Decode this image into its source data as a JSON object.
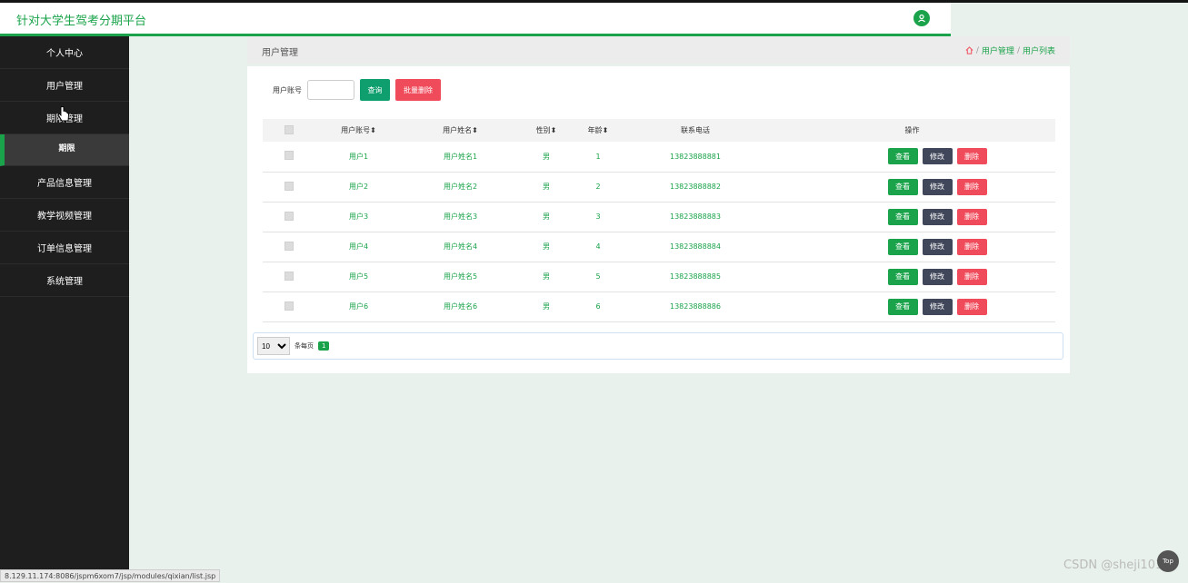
{
  "header": {
    "brand": "针对大学生驾考分期平台",
    "user_icon": "user-icon"
  },
  "sidebar": {
    "items": [
      {
        "label": "个人中心"
      },
      {
        "label": "用户管理"
      },
      {
        "label": "期限管理"
      },
      {
        "label": "期限"
      },
      {
        "label": "产品信息管理"
      },
      {
        "label": "教学视频管理"
      },
      {
        "label": "订单信息管理"
      },
      {
        "label": "系统管理"
      }
    ]
  },
  "breadcrumb": {
    "title": "用户管理",
    "home_icon": "home-icon",
    "sep": "/",
    "level1": "用户管理",
    "level2": "用户列表"
  },
  "search": {
    "label": "用户账号",
    "value": "",
    "query_label": "查询",
    "batch_delete_label": "批量删除"
  },
  "table": {
    "columns": [
      "用户账号",
      "用户姓名",
      "性别",
      "年龄",
      "联系电话",
      "操作"
    ],
    "rows": [
      {
        "account": "用户1",
        "name": "用户姓名1",
        "gender": "男",
        "age": "1",
        "phone": "13823888881"
      },
      {
        "account": "用户2",
        "name": "用户姓名2",
        "gender": "男",
        "age": "2",
        "phone": "13823888882"
      },
      {
        "account": "用户3",
        "name": "用户姓名3",
        "gender": "男",
        "age": "3",
        "phone": "13823888883"
      },
      {
        "account": "用户4",
        "name": "用户姓名4",
        "gender": "男",
        "age": "4",
        "phone": "13823888884"
      },
      {
        "account": "用户5",
        "name": "用户姓名5",
        "gender": "男",
        "age": "5",
        "phone": "13823888885"
      },
      {
        "account": "用户6",
        "name": "用户姓名6",
        "gender": "男",
        "age": "6",
        "phone": "13823888886"
      }
    ],
    "actions": {
      "view": "查看",
      "edit": "修改",
      "delete": "删除"
    }
  },
  "pager": {
    "page_size": "10",
    "per_page_label": "条每页",
    "current_page": "1"
  },
  "statusbar": {
    "url": "8.129.11.174:8086/jspm6xom7/jsp/modules/qixian/list.jsp"
  },
  "watermark": "CSDN @sheji1011",
  "top_button": "Top",
  "colors": {
    "primary": "#1aa34a",
    "danger": "#f04b5b",
    "dark": "#40475a",
    "sidebar": "#1e1e1e"
  }
}
